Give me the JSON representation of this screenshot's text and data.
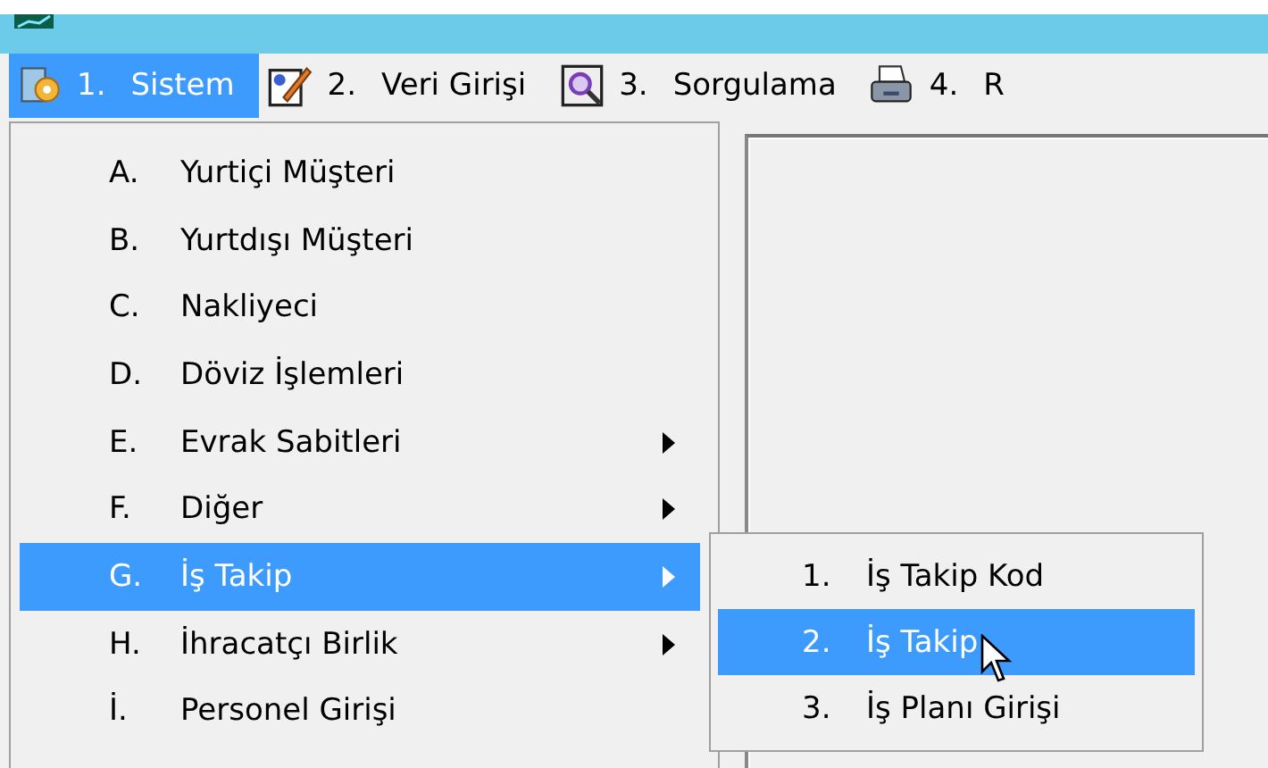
{
  "menu_bar": [
    {
      "number": "1.",
      "label": "Sistem",
      "selected": true
    },
    {
      "number": "2.",
      "label": "Veri Girişi",
      "selected": false
    },
    {
      "number": "3.",
      "label": "Sorgulama",
      "selected": false
    },
    {
      "number": "4.",
      "label": "R",
      "selected": false
    }
  ],
  "dropdown": [
    {
      "key": "A.",
      "label": "Yurtiçi Müşteri",
      "has_submenu": false,
      "selected": false
    },
    {
      "key": "B.",
      "label": "Yurtdışı Müşteri",
      "has_submenu": false,
      "selected": false
    },
    {
      "key": "C.",
      "label": "Nakliyeci",
      "has_submenu": false,
      "selected": false
    },
    {
      "key": "D.",
      "label": "Döviz İşlemleri",
      "has_submenu": false,
      "selected": false
    },
    {
      "key": "E.",
      "label": "Evrak Sabitleri",
      "has_submenu": true,
      "selected": false
    },
    {
      "key": "F.",
      "label": "Diğer",
      "has_submenu": true,
      "selected": false
    },
    {
      "key": "G.",
      "label": "İş Takip",
      "has_submenu": true,
      "selected": true
    },
    {
      "key": "H.",
      "label": "İhracatçı Birlik",
      "has_submenu": true,
      "selected": false
    },
    {
      "key": "İ.",
      "label": "Personel Girişi",
      "has_submenu": false,
      "selected": false
    }
  ],
  "submenu": [
    {
      "key": "1.",
      "label": "İş Takip Kod",
      "selected": false
    },
    {
      "key": "2.",
      "label": "İş Takip",
      "selected": true
    },
    {
      "key": "3.",
      "label": "İş Planı Girişi",
      "selected": false
    }
  ]
}
